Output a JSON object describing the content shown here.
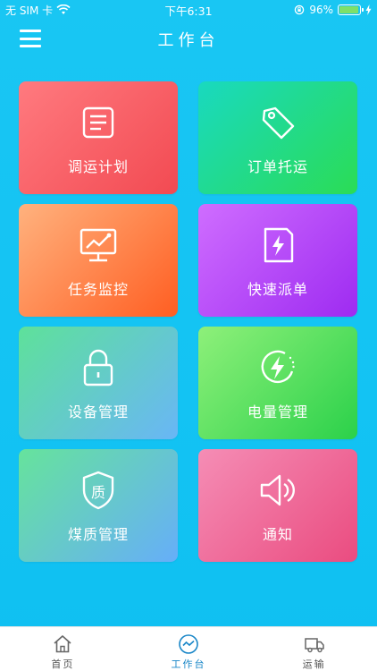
{
  "status_bar": {
    "carrier": "无 SIM 卡",
    "time": "下午6:31",
    "battery": "96%",
    "battery_level": 0.96
  },
  "header": {
    "title": "工作台",
    "menu_icon": "hamburger-menu-icon"
  },
  "tiles": [
    {
      "label": "调运计划",
      "icon": "document-list-icon"
    },
    {
      "label": "订单托运",
      "icon": "tag-icon"
    },
    {
      "label": "任务监控",
      "icon": "monitor-chart-icon"
    },
    {
      "label": "快速派单",
      "icon": "lightning-document-icon"
    },
    {
      "label": "设备管理",
      "icon": "lock-icon"
    },
    {
      "label": "电量管理",
      "icon": "power-lightning-icon"
    },
    {
      "label": "煤质管理",
      "icon": "shield-quality-icon"
    },
    {
      "label": "通知",
      "icon": "speaker-icon"
    }
  ],
  "tab_bar": {
    "items": [
      {
        "label": "首页",
        "icon": "home-icon",
        "active": false
      },
      {
        "label": "工作台",
        "icon": "activity-circle-icon",
        "active": true
      },
      {
        "label": "运输",
        "icon": "truck-icon",
        "active": false
      }
    ]
  },
  "colors": {
    "background": "#13c3f3",
    "tab_active": "#1a87c8",
    "tab_inactive": "#555555"
  }
}
